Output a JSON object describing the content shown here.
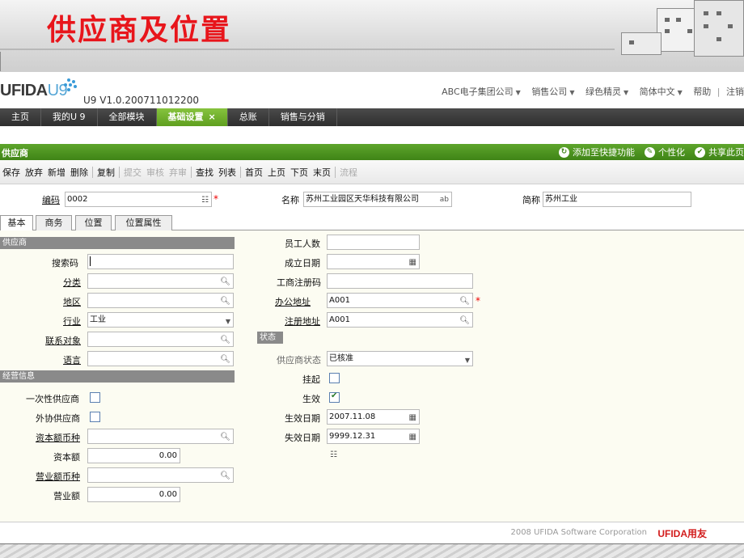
{
  "slide": {
    "title": "供应商及位置"
  },
  "app": {
    "logo_brand": "UFIDA",
    "logo_product": "U9",
    "version": "U9 V1.0.200711012200",
    "top_links": [
      "ABC电子集团公司",
      "销售公司",
      "绿色精灵",
      "简体中文",
      "帮助",
      "注销"
    ]
  },
  "nav": {
    "items": [
      "主页",
      "我的U 9",
      "全部模块",
      "基础设置",
      "总账",
      "销售与分销"
    ],
    "active_index": 3,
    "close_glyph": "×"
  },
  "form": {
    "title": "供应商",
    "actions": [
      "添加至快捷功能",
      "个性化",
      "共享此页"
    ]
  },
  "toolbar": {
    "buttons": [
      "保存",
      "放弃",
      "新增",
      "删除",
      "复制",
      "提交",
      "审核",
      "弃审",
      "查找",
      "列表",
      "首页",
      "上页",
      "下页",
      "末页",
      "流程"
    ],
    "disabled": [
      "提交",
      "审核",
      "弃审",
      "流程"
    ]
  },
  "header": {
    "code_label": "编码",
    "code_value": "0002",
    "name_label": "名称",
    "name_value": "苏州工业园区天华科技有限公司",
    "name_badge": "ab",
    "short_label": "简称",
    "short_value": "苏州工业"
  },
  "tabs": [
    "基本",
    "商务",
    "位置",
    "位置属性"
  ],
  "sections": {
    "supplier": "供应商",
    "business": "经营信息",
    "status": "状态"
  },
  "left": {
    "search_code": "搜索码",
    "category": "分类",
    "region": "地区",
    "industry": "行业",
    "industry_value": "工业",
    "contact": "联系对象",
    "language": "语言"
  },
  "business": {
    "one_time": "一次性供应商",
    "outsourced": "外协供应商",
    "capital_currency": "资本额币种",
    "capital": "资本额",
    "capital_value": "0.00",
    "revenue_currency": "营业额币种",
    "revenue": "营业额",
    "revenue_value": "0.00"
  },
  "right": {
    "employees": "员工人数",
    "established": "成立日期",
    "reg_no": "工商注册码",
    "office_addr": "办公地址",
    "office_addr_value": "A001",
    "reg_addr": "注册地址",
    "reg_addr_value": "A001"
  },
  "status": {
    "state_label": "供应商状态",
    "state_value": "已核准",
    "suspend": "挂起",
    "effective": "生效",
    "eff_date": "生效日期",
    "eff_date_value": "2007.11.08",
    "exp_date": "失效日期",
    "exp_date_value": "9999.12.31"
  },
  "footer": {
    "copyright": "2008 UFIDA Software Corporation",
    "brand": "UFIDA用友"
  }
}
